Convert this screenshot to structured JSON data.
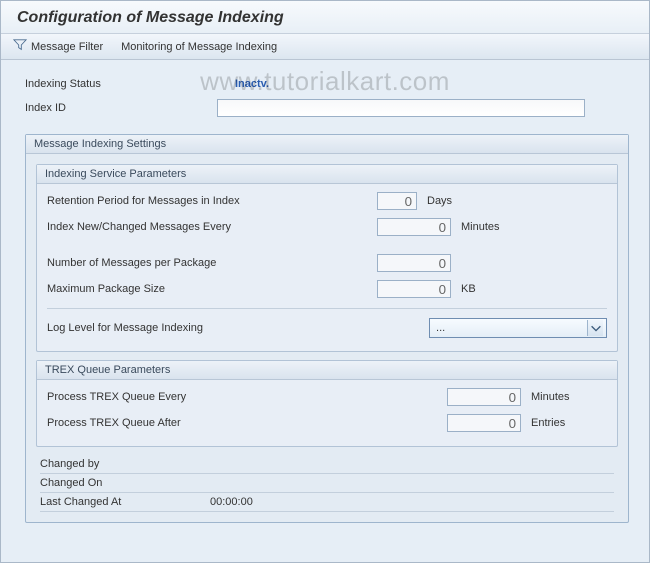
{
  "header": {
    "title": "Configuration of Message Indexing"
  },
  "toolbar": {
    "message_filter": "Message Filter",
    "monitoring": "Monitoring of Message Indexing"
  },
  "watermark": "www.tutorialkart.com",
  "status": {
    "indexing_status_label": "Indexing Status",
    "indexing_status_value": "Inactv.",
    "index_id_label": "Index ID",
    "index_id_value": ""
  },
  "settings": {
    "title": "Message Indexing Settings",
    "service": {
      "title": "Indexing Service Parameters",
      "retention_label": "Retention Period for Messages in Index",
      "retention_value": "0",
      "retention_unit": "Days",
      "index_every_label": "Index New/Changed Messages Every",
      "index_every_value": "0",
      "index_every_unit": "Minutes",
      "msgs_per_pkg_label": "Number of Messages per Package",
      "msgs_per_pkg_value": "0",
      "max_pkg_label": "Maximum Package Size",
      "max_pkg_value": "0",
      "max_pkg_unit": "KB",
      "log_level_label": "Log Level for Message Indexing",
      "log_level_value": "..."
    },
    "trex": {
      "title": "TREX Queue Parameters",
      "every_label": "Process TREX Queue Every",
      "every_value": "0",
      "every_unit": "Minutes",
      "after_label": "Process TREX Queue After",
      "after_value": "0",
      "after_unit": "Entries"
    }
  },
  "footer": {
    "changed_by_label": "Changed by",
    "changed_by_value": "",
    "changed_on_label": "Changed On",
    "changed_on_value": "",
    "last_changed_label": "Last Changed At",
    "last_changed_value": "00:00:00"
  }
}
